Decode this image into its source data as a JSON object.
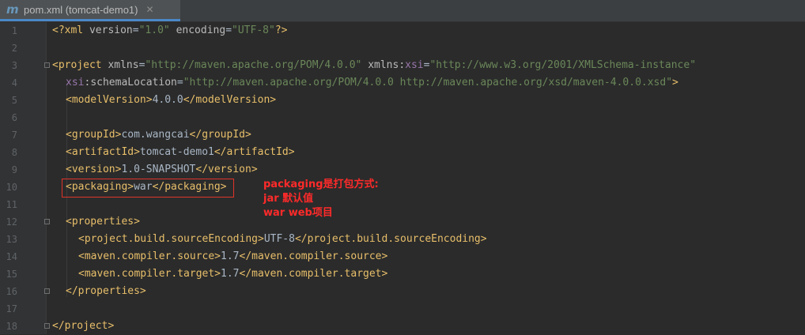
{
  "tab": {
    "icon": "m",
    "title": "pom.xml (tomcat-demo1)",
    "close": "✕"
  },
  "lines": [
    {
      "n": "1"
    },
    {
      "n": "2"
    },
    {
      "n": "3"
    },
    {
      "n": "4"
    },
    {
      "n": "5"
    },
    {
      "n": "6"
    },
    {
      "n": "7"
    },
    {
      "n": "8"
    },
    {
      "n": "9"
    },
    {
      "n": "10"
    },
    {
      "n": "11"
    },
    {
      "n": "12"
    },
    {
      "n": "13"
    },
    {
      "n": "14"
    },
    {
      "n": "15"
    },
    {
      "n": "16"
    },
    {
      "n": "17"
    },
    {
      "n": "18"
    }
  ],
  "code": {
    "l1": {
      "open": "<?xml ",
      "a1": "version",
      "e1": "=",
      "v1": "\"1.0\"",
      "sp": " ",
      "a2": "encoding",
      "e2": "=",
      "v2": "\"UTF-8\"",
      "close": "?>"
    },
    "l3": {
      "open": "<project ",
      "a1": "xmlns",
      "e1": "=",
      "v1": "\"http://maven.apache.org/POM/4.0.0\"",
      "sp": " ",
      "a2": "xmlns",
      "c2": ":",
      "ns2": "xsi",
      "e2": "=",
      "v2": "\"http://www.w3.org/2001/XMLSchema-instance\""
    },
    "l4": {
      "ns": "xsi",
      "colon": ":",
      "attr": "schemaLocation",
      "eq": "=",
      "val": "\"http://maven.apache.org/POM/4.0.0 http://maven.apache.org/xsd/maven-4.0.0.xsd\"",
      "close": ">"
    },
    "l5": {
      "open": "<modelVersion>",
      "text": "4.0.0",
      "close": "</modelVersion>"
    },
    "l7": {
      "open": "<groupId>",
      "text": "com.wangcai",
      "close": "</groupId>"
    },
    "l8": {
      "open": "<artifactId>",
      "text": "tomcat-demo1",
      "close": "</artifactId>"
    },
    "l9": {
      "open": "<version>",
      "text": "1.0-SNAPSHOT",
      "close": "</version>"
    },
    "l10": {
      "open": "<packaging>",
      "text": "war",
      "close": "</packaging>"
    },
    "l12": {
      "open": "<properties>"
    },
    "l13": {
      "open": "<project.build.sourceEncoding>",
      "text": "UTF-8",
      "close": "</project.build.sourceEncoding>"
    },
    "l14": {
      "open": "<maven.compiler.source>",
      "text": "1.7",
      "close": "</maven.compiler.source>"
    },
    "l15": {
      "open": "<maven.compiler.target>",
      "text": "1.7",
      "close": "</maven.compiler.target>"
    },
    "l16": {
      "close": "</properties>"
    },
    "l18": {
      "close": "</project>"
    }
  },
  "annotation": {
    "line1": "packaging是打包方式:",
    "line2": "jar 默认值",
    "line3": "war web项目"
  },
  "colors": {
    "tag": "#e8bf6a",
    "attr": "#bababa",
    "value": "#6a8759",
    "namespace": "#9876aa",
    "annotation": "#ff2a2a"
  }
}
